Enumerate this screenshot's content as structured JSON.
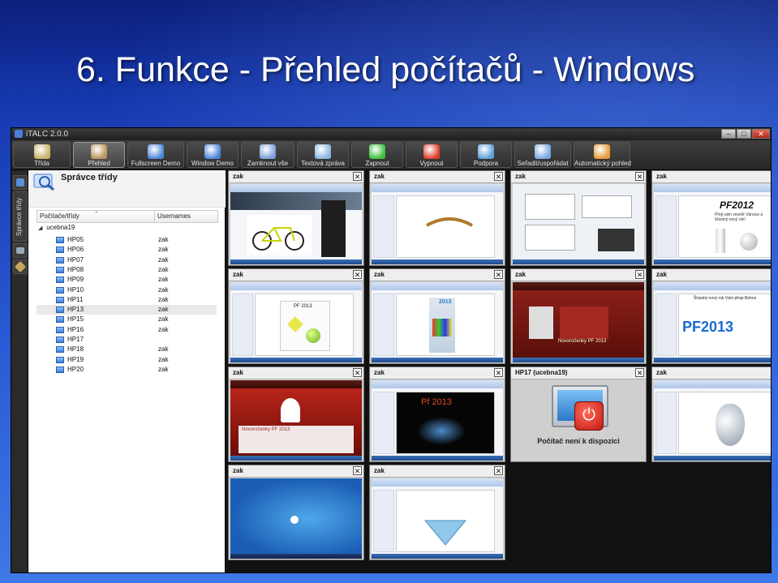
{
  "slide": {
    "title": "6. Funkce - Přehled počítačů - Windows"
  },
  "window": {
    "title": "iTALC 2.0.0"
  },
  "toolbar": {
    "buttons": [
      {
        "label": "Třída",
        "color": "#c9b26a"
      },
      {
        "label": "Přehled",
        "color": "#b8945a"
      },
      {
        "label": "Fullscreen Demo",
        "color": "#4f86d9"
      },
      {
        "label": "Window Demo",
        "color": "#4f86d9"
      },
      {
        "label": "Zamknout vše",
        "color": "#7aa0d8"
      },
      {
        "label": "Textová zpráva",
        "color": "#8ab6e0"
      },
      {
        "label": "Zapnout",
        "color": "#3cbf3c"
      },
      {
        "label": "Vypnout",
        "color": "#e23a2a"
      },
      {
        "label": "Podpora",
        "color": "#5c9fd8"
      },
      {
        "label": "Seřadit/uspořádat",
        "color": "#7aa8e0"
      },
      {
        "label": "Automatický pohled",
        "color": "#e89a3a"
      }
    ]
  },
  "sidebar": {
    "tab_label": "Správce třídy"
  },
  "panel": {
    "title": "Správce třídy",
    "col_computers": "Počítače/třídy",
    "col_users": "Usernames",
    "group": "ucebna19",
    "rows": [
      {
        "name": "HP05",
        "user": "zak"
      },
      {
        "name": "HP06",
        "user": "zak"
      },
      {
        "name": "HP07",
        "user": "zak"
      },
      {
        "name": "HP08",
        "user": "zak"
      },
      {
        "name": "HP09",
        "user": "zak"
      },
      {
        "name": "HP10",
        "user": "zak"
      },
      {
        "name": "HP11",
        "user": "zak"
      },
      {
        "name": "HP13",
        "user": "zak"
      },
      {
        "name": "HP15",
        "user": "zak"
      },
      {
        "name": "HP16",
        "user": "zak"
      },
      {
        "name": "HP17",
        "user": ""
      },
      {
        "name": "HP18",
        "user": "zak"
      },
      {
        "name": "HP19",
        "user": "zak"
      },
      {
        "name": "HP20",
        "user": "zak"
      }
    ]
  },
  "grid": {
    "cells": [
      {
        "user": "zak",
        "screen": "web-bike"
      },
      {
        "user": "zak",
        "screen": "doc-happy"
      },
      {
        "user": "zak",
        "screen": "desktop-windows"
      },
      {
        "user": "zak",
        "screen": "doc-pf2012"
      },
      {
        "user": "zak",
        "screen": "doc-pf2013-card"
      },
      {
        "user": "zak",
        "screen": "doc-2013-collage"
      },
      {
        "user": "zak",
        "screen": "web-red"
      },
      {
        "user": "zak",
        "screen": "doc-pf2013-logo"
      },
      {
        "user": "zak",
        "screen": "web-red-santa"
      },
      {
        "user": "zak",
        "screen": "dark-pf2013"
      },
      {
        "user": "HP17 (ucebna19)",
        "screen": "unavailable"
      },
      {
        "user": "zak",
        "screen": "doc-3d-shape"
      },
      {
        "user": "zak",
        "screen": "desktop-blue"
      },
      {
        "user": "zak",
        "screen": "doc-triangle"
      }
    ],
    "texts": {
      "unavailable": "Počítač není k dispozici",
      "pf2012": "PF2012",
      "pf2012_sub": "Přeji vám veselé Vánoce a šťastný nový rok!",
      "pf2013": "PF 2013",
      "year": "2013",
      "pf_greeting": "Šťastný nový rok Vám přeje Bohox",
      "pf_logo": "PF2013",
      "web_title": "Novoročenky PF 2013",
      "dark_title": "Pf 2013"
    }
  },
  "close_glyph": "✕"
}
